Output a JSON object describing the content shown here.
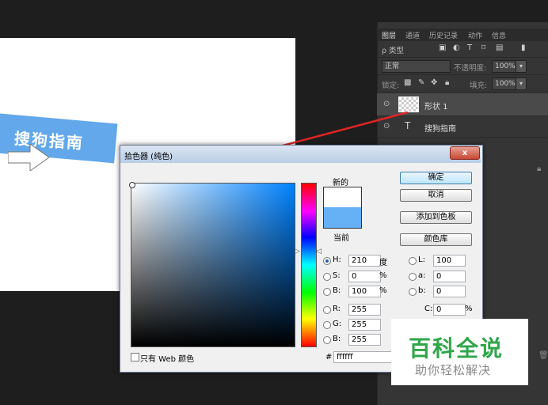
{
  "canvas": {
    "banner_text": "搜狗指南"
  },
  "layers_panel": {
    "tabs": [
      "图层",
      "通道",
      "历史记录",
      "动作",
      "信息"
    ],
    "filter_label": "ρ 类型",
    "blend_mode": "正常",
    "opacity_label": "不透明度:",
    "opacity_value": "100%",
    "lock_label": "锁定:",
    "fill_label": "填充:",
    "fill_value": "100%",
    "layers": [
      {
        "name": "形状 1"
      },
      {
        "name": "搜狗指南"
      }
    ],
    "type_icon": "T",
    "eye_icon": "⊙"
  },
  "dialog": {
    "title": "拾色器 (纯色)",
    "close": "x",
    "new_label": "新的",
    "current_label": "当前",
    "buttons": {
      "ok": "确定",
      "cancel": "取消",
      "add_swatch": "添加到色板",
      "libraries": "颜色库"
    },
    "hsb": [
      {
        "label": "H:",
        "value": "210",
        "unit": "度",
        "selected": true
      },
      {
        "label": "S:",
        "value": "0",
        "unit": "%"
      },
      {
        "label": "B:",
        "value": "100",
        "unit": "%"
      }
    ],
    "rgb": [
      {
        "label": "R:",
        "value": "255"
      },
      {
        "label": "G:",
        "value": "255"
      },
      {
        "label": "B:",
        "value": "255"
      }
    ],
    "lab": [
      {
        "label": "L:",
        "value": "100"
      },
      {
        "label": "a:",
        "value": "0"
      },
      {
        "label": "b:",
        "value": "0"
      }
    ],
    "cmyk_c": {
      "label": "C:",
      "value": "0",
      "unit": "%"
    },
    "hex_label": "#",
    "hex_value": "ffffff",
    "web_only": "只有 Web 颜色",
    "new_color": "#ffffff",
    "current_color": "#66b0f5"
  },
  "watermark": {
    "title": "百科全说",
    "subtitle": "助你轻松解决"
  }
}
